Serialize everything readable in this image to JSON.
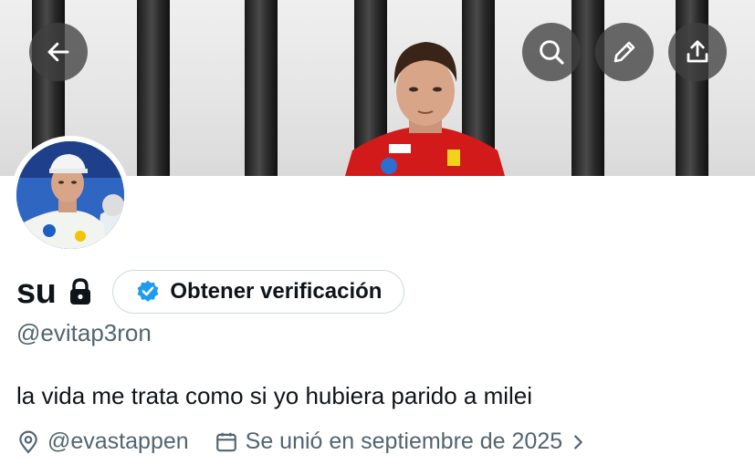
{
  "profile": {
    "display_name": "su",
    "handle": "@evitap3ron",
    "bio": "la vida me trata como si yo hubiera parido a milei",
    "location": "@evastappen",
    "joined": "Se unió en septiembre de 2025",
    "verify_label": "Obtener verificación"
  },
  "colors": {
    "accent": "#1d9bf0",
    "text": "#0f1419",
    "muted": "#536471",
    "button_overlay": "#404040"
  },
  "icons": {
    "back": "arrow-left-icon",
    "search": "search-icon",
    "edit": "pencil-icon",
    "share": "share-icon",
    "lock": "lock-icon",
    "verified": "verified-badge-icon",
    "location": "location-pin-icon",
    "calendar": "calendar-icon",
    "chevron": "chevron-right-icon"
  }
}
